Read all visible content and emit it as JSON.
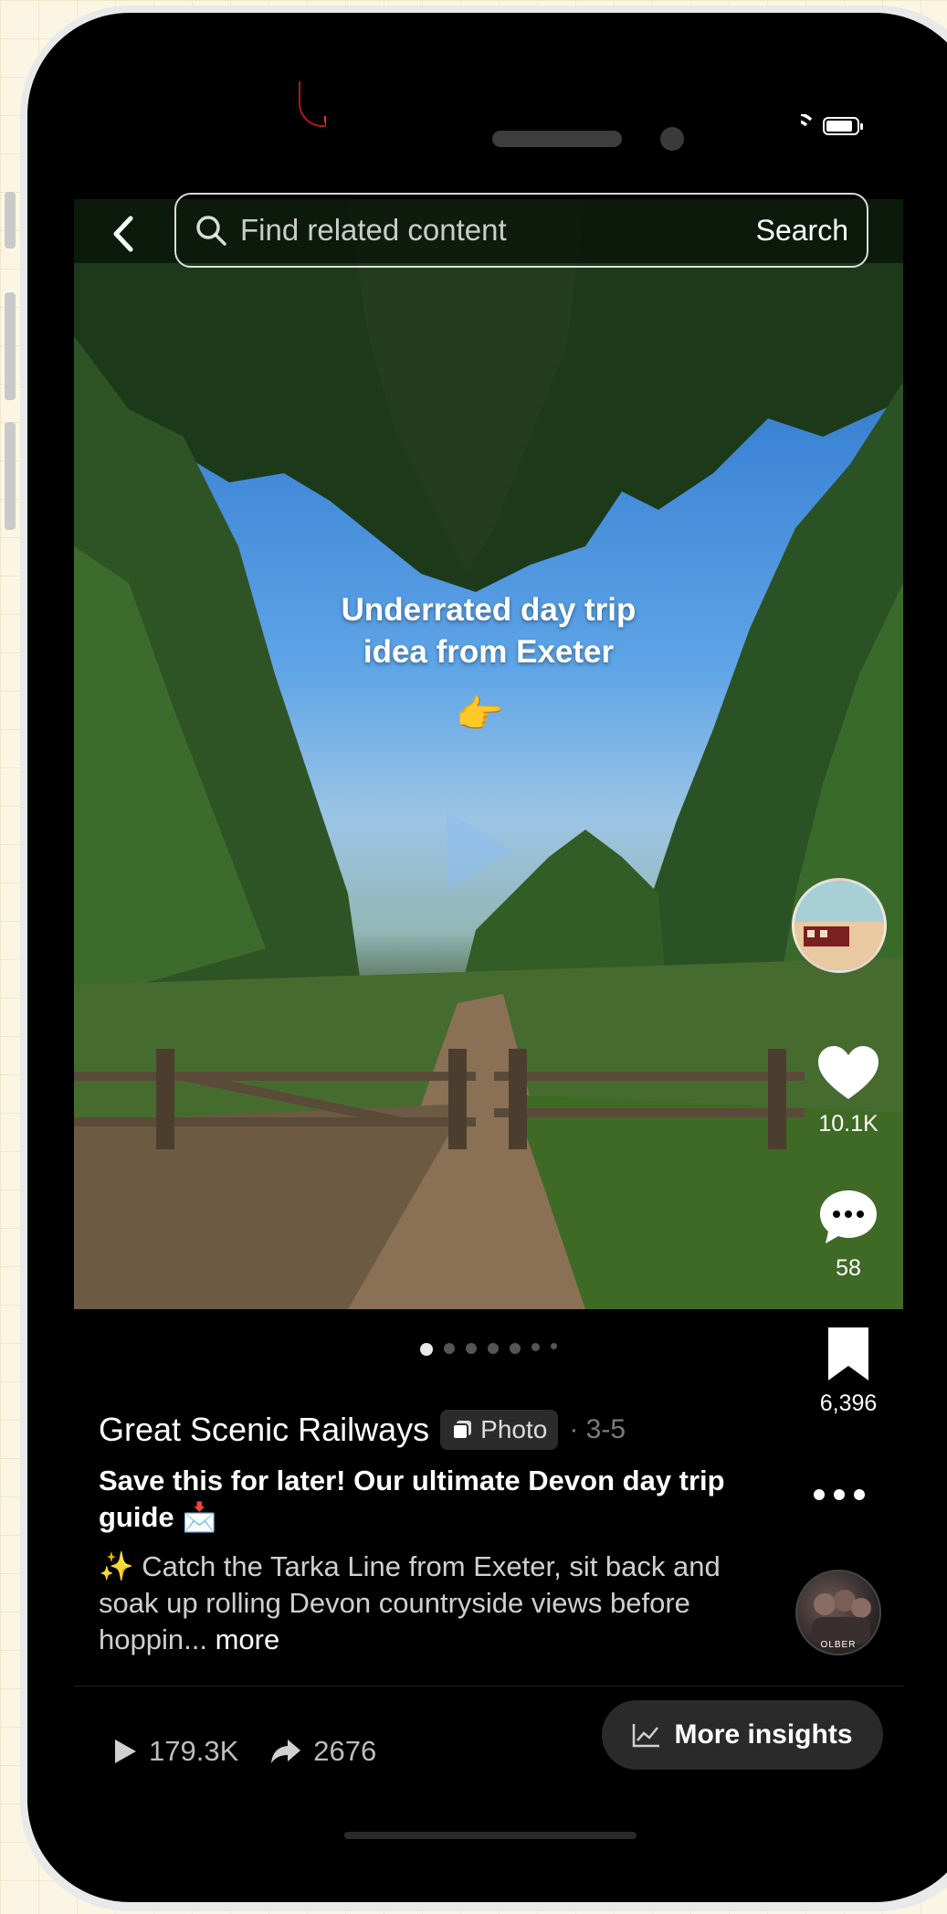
{
  "search": {
    "placeholder": "Find related content",
    "button_label": "Search"
  },
  "media": {
    "overlay_line1": "Underrated day trip",
    "overlay_line2": "idea from Exeter",
    "overlay_emoji": "👉",
    "slide_count": 7,
    "active_slide": 0
  },
  "actions": {
    "likes": "10.1K",
    "comments": "58",
    "saves": "6,396"
  },
  "post": {
    "author": "Great Scenic Railways",
    "type_label": "Photo",
    "date": "· 3-5",
    "title": "Save this for later! Our ultimate Devon day trip guide 📩",
    "body": "✨  Catch the Tarka Line from Exeter, sit back and soak up rolling Devon countryside views before hoppin...",
    "more_label": "more",
    "channel_avatar_text": "OLBER"
  },
  "stats": {
    "plays": "179.3K",
    "shares": "2676",
    "insights_label": "More insights"
  }
}
